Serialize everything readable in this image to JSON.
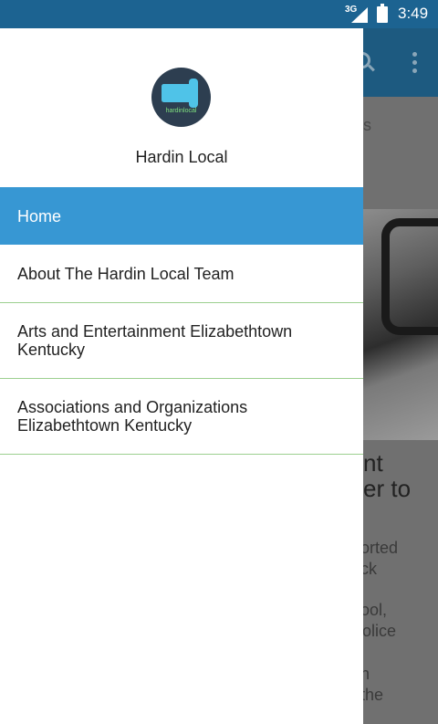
{
  "status_bar": {
    "network": "3G",
    "time": "3:49"
  },
  "drawer": {
    "logo_text": "hardinlocal",
    "app_name": "Hardin Local",
    "menu": [
      {
        "label": "Home",
        "active": true
      },
      {
        "label": "About The Hardin Local Team",
        "active": false
      },
      {
        "label": "Arts and Entertainment Elizabethtown Kentucky",
        "active": false
      },
      {
        "label": "Associations and Organizations Elizabethtown Kentucky",
        "active": false
      }
    ]
  },
  "background": {
    "partial_s": "s",
    "headline_line1": "nt",
    "headline_line2": "er to",
    "para1_line1": "ported",
    "para1_line2": "uck",
    "para2_line1": "hool,",
    "para2_line2": "Police",
    "para3_line1": "an",
    "para3_line2": "f the"
  }
}
